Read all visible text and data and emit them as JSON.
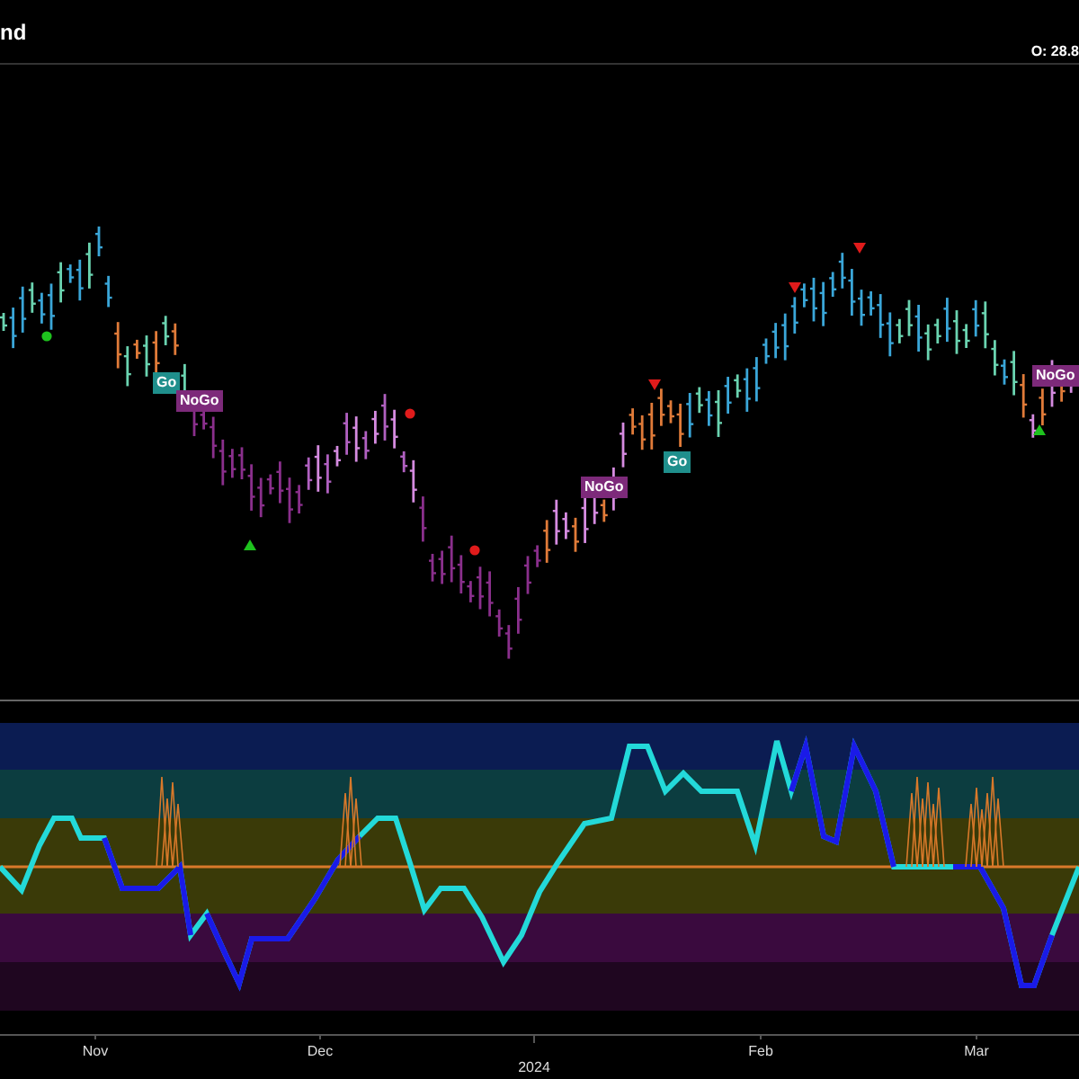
{
  "header": {
    "title_fragment": "nd",
    "ohlc_reading": "O: 28.8"
  },
  "signals": [
    {
      "label": "Go",
      "kind": "go"
    },
    {
      "label": "NoGo",
      "kind": "nogo"
    },
    {
      "label": "NoGo",
      "kind": "nogo"
    },
    {
      "label": "Go",
      "kind": "go"
    },
    {
      "label": "NoGo",
      "kind": "nogo"
    }
  ],
  "x_axis": {
    "labels": [
      "Nov",
      "Dec",
      "Feb",
      "Mar"
    ],
    "year_label": "2024"
  }
}
